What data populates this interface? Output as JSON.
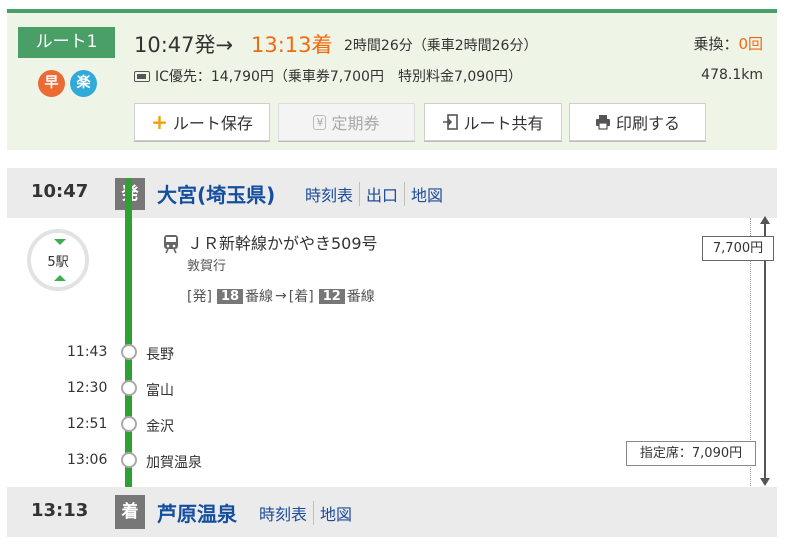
{
  "summary": {
    "route_label": "ルート1",
    "fast_badge": "早",
    "easy_badge": "楽",
    "dep_time": "10:47発→",
    "arr_time": "13:13着",
    "duration": "2時間26分（乗車2時間26分）",
    "transfer_label": "乗換：",
    "transfer_count": "0回",
    "ic_text": "IC優先：14,790円（乗車券7,700円　特別料金7,090円）",
    "distance": "478.1km",
    "buttons": {
      "save": "ルート保存",
      "teiki": "定期券",
      "share": "ルート共有",
      "print": "印刷する"
    }
  },
  "departure": {
    "time": "10:47",
    "marker": "発",
    "station": "大宮(埼玉県)",
    "links": [
      "時刻表",
      "出口",
      "地図"
    ]
  },
  "segment": {
    "station_count": "5駅",
    "train": "ＪＲ新幹線かがやき509号",
    "destination": "敦賀行",
    "dep_track_prefix": "[発]",
    "dep_track": "18",
    "track_suffix": "番線",
    "arrow": "→",
    "arr_track_prefix": "[着]",
    "arr_track": "12",
    "fare": "7,700円",
    "reserved": "指定席：7,090円",
    "stops": [
      {
        "time": "11:43",
        "name": "長野"
      },
      {
        "time": "12:30",
        "name": "富山"
      },
      {
        "time": "12:51",
        "name": "金沢"
      },
      {
        "time": "13:06",
        "name": "加賀温泉"
      }
    ]
  },
  "arrival": {
    "time": "13:13",
    "marker": "着",
    "station": "芦原温泉",
    "links": [
      "時刻表",
      "地図"
    ]
  }
}
